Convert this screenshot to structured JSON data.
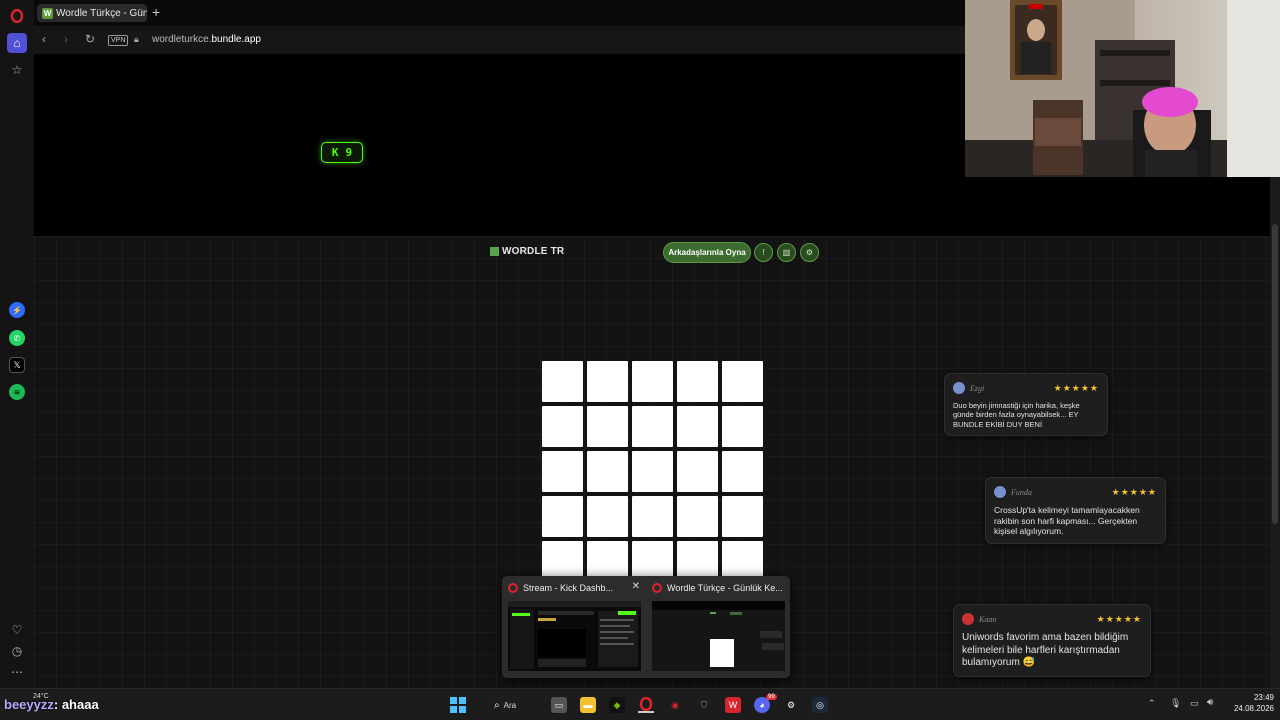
{
  "browser": {
    "tab_title": "Wordle Türkçe - Günlük K",
    "tab_favicon_letter": "W",
    "new_tab_symbol": "+",
    "vpn_label": "VPN",
    "url_prefix": "wordleturkce.",
    "url_domain": "bundle.app"
  },
  "kick_badge": {
    "logo": "K",
    "count": "9"
  },
  "game": {
    "logo_text": "WORDLE TR",
    "play_with_friends_label": "Arkadaşlarınla Oyna",
    "grid_rows": 5,
    "grid_cols": 5
  },
  "reviews": [
    {
      "name": "Ezgi",
      "stars": "★★★★★",
      "text": "Duo beyin jimnastiği için harika, keşke günde birden fazla oynayabilsek... EY BUNDLE EKİBİ DUY BENİ"
    },
    {
      "name": "Funda",
      "stars": "★★★★★",
      "text": "CrossUp'ta kelimeyi tamamlayacakken rakibin son harfi kapması... Gerçekten kişisel algılıyorum."
    },
    {
      "name": "Kaan",
      "stars": "★★★★★",
      "text": "Uniwords favorim ama bazen bildiğim kelimeleri bile harfleri karıştırmadan bulamıyorum 😅"
    }
  ],
  "taskbar_preview": {
    "items": [
      {
        "title": "Stream - Kick Dashb...",
        "close": "✕"
      },
      {
        "title": "Wordle Türkçe - Günlük Ke..."
      }
    ]
  },
  "taskbar": {
    "search_label": "Ara",
    "weather": "24°C",
    "time": "23:49",
    "date": "24.08.2026",
    "notification_count": "99"
  },
  "chat_overlay": {
    "user": "beeyyzz",
    "message": ": ahaaa"
  },
  "colors": {
    "kick_green": "#53fc18",
    "wordle_green": "#59a14f",
    "star_yellow": "#f2c230",
    "opera_red": "#e0232a"
  }
}
